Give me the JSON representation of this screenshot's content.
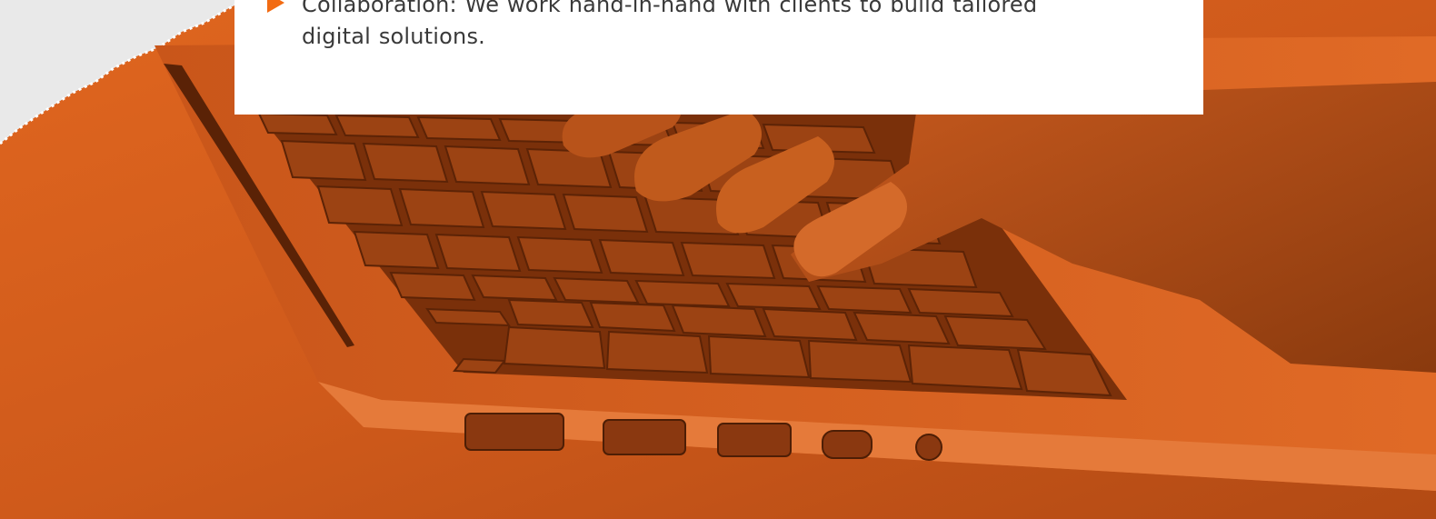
{
  "colors": {
    "accent": "#f26b12",
    "background_orange": "#d25a1c",
    "card_background": "#ffffff",
    "text": "#3a3a3a"
  },
  "card": {
    "bullet_icon": "triangle-right-icon",
    "bullet_line_1": "Collaboration: We work hand-in-hand with clients to build tailored",
    "bullet_line_2": "digital solutions."
  }
}
